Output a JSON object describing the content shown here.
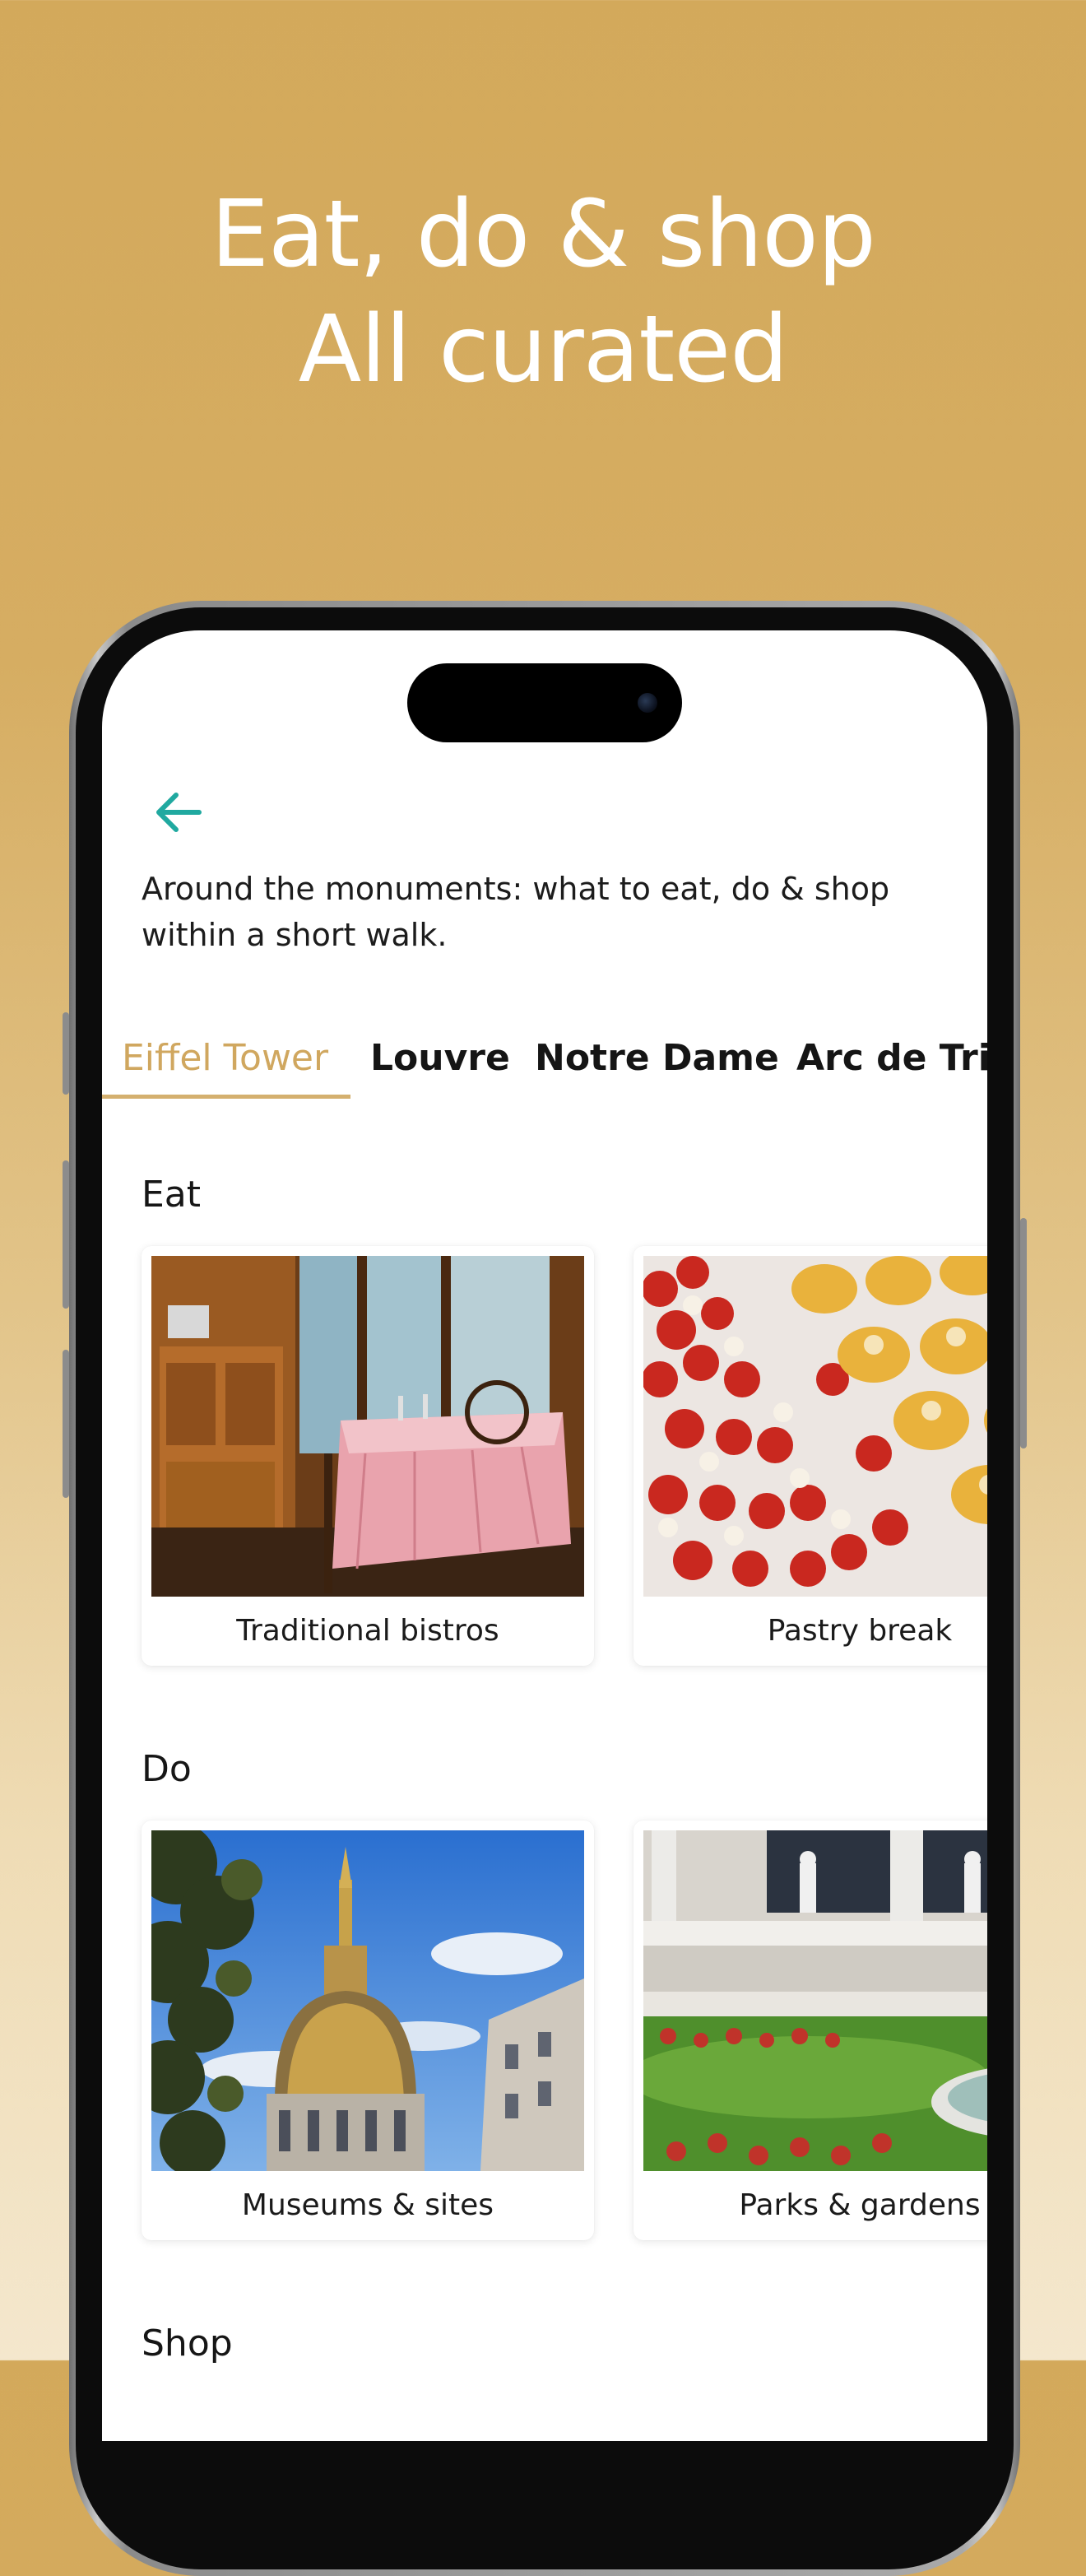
{
  "headline": {
    "line1": "Eat, do & shop",
    "line2": "All curated"
  },
  "screen": {
    "intro": "Around the monuments: what to eat, do & shop within a short walk.",
    "tabs": [
      {
        "label": "Eiffel Tower",
        "active": true
      },
      {
        "label": "Louvre",
        "active": false
      },
      {
        "label": "Notre Dame",
        "active": false
      },
      {
        "label": "Arc de Triomphe",
        "active": false
      }
    ],
    "sections": {
      "eat": {
        "title": "Eat",
        "cards": [
          {
            "label": "Traditional bistros",
            "image": "bistro-interior-photo"
          },
          {
            "label": "Pastry break",
            "image": "pastries-photo"
          }
        ]
      },
      "do": {
        "title": "Do",
        "cards": [
          {
            "label": "Museums & sites",
            "image": "golden-dome-photo"
          },
          {
            "label": "Parks & gardens",
            "image": "garden-fountain-photo"
          }
        ]
      },
      "shop": {
        "title": "Shop"
      }
    }
  },
  "colors": {
    "background_top": "#d3a95b",
    "background_bottom": "#f4e7cd",
    "accent_gold": "#d0a75f",
    "back_arrow_teal": "#20a9a0"
  }
}
